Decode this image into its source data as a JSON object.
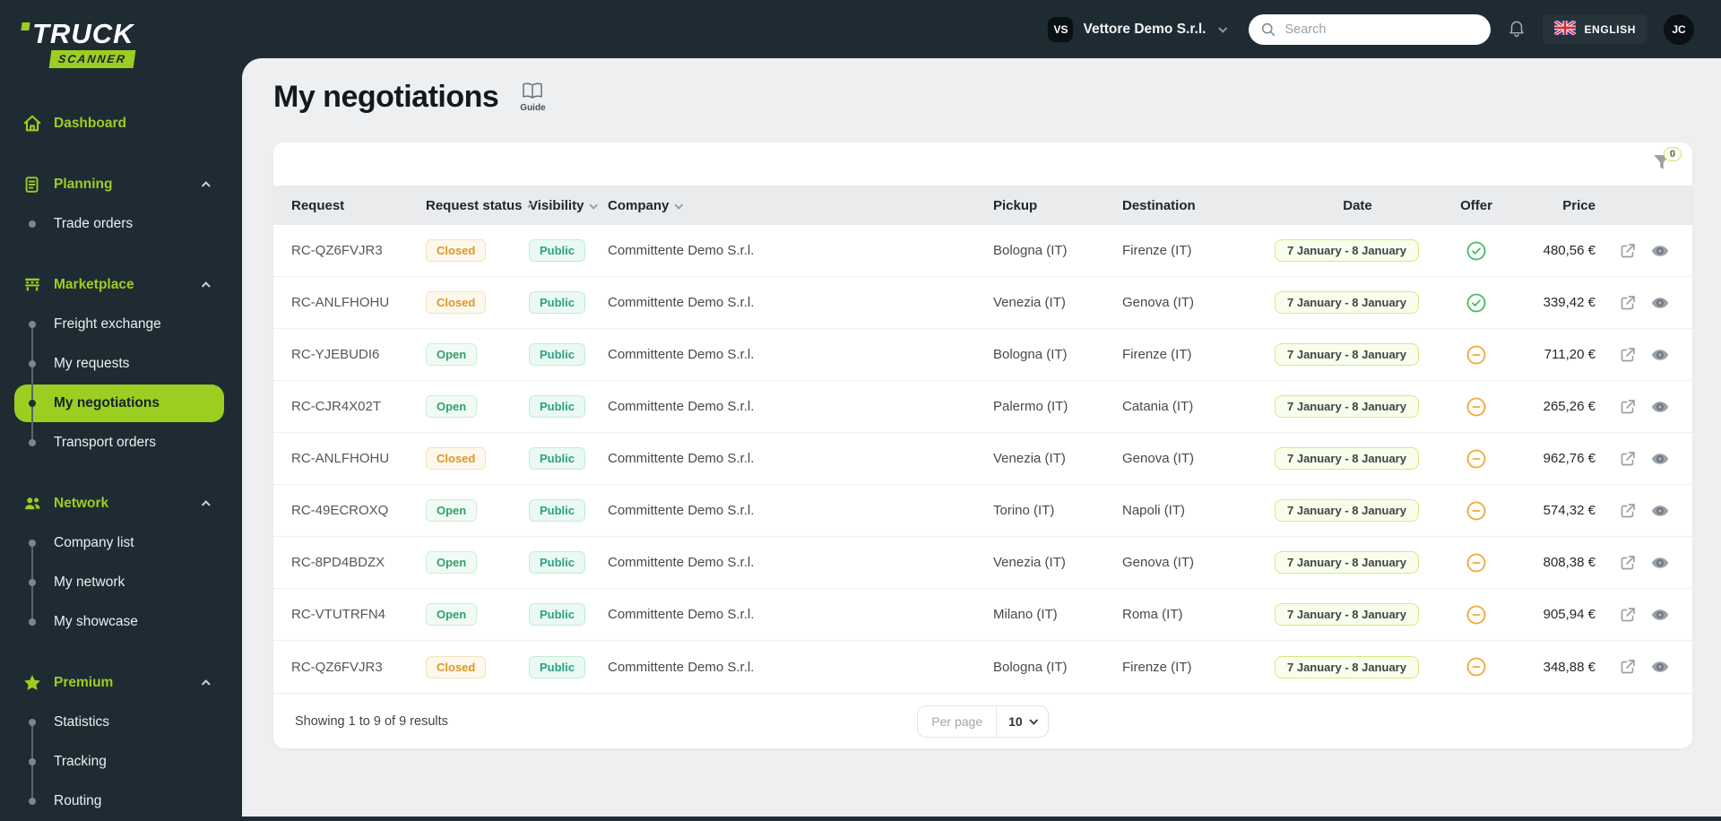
{
  "brand": {
    "name_line1": "TRUCK",
    "name_line2": "SCANNER"
  },
  "topbar": {
    "org_initials": "VS",
    "org_name": "Vettore Demo S.r.l.",
    "search_placeholder": "Search",
    "language_label": "ENGLISH",
    "user_initials": "JC"
  },
  "sidebar": {
    "sections": [
      {
        "label": "Dashboard",
        "items": []
      },
      {
        "label": "Planning",
        "items": [
          {
            "label": "Trade orders"
          }
        ]
      },
      {
        "label": "Marketplace",
        "items": [
          {
            "label": "Freight exchange"
          },
          {
            "label": "My requests"
          },
          {
            "label": "My negotiations",
            "active": true
          },
          {
            "label": "Transport orders"
          }
        ]
      },
      {
        "label": "Network",
        "items": [
          {
            "label": "Company list"
          },
          {
            "label": "My network"
          },
          {
            "label": "My showcase"
          }
        ]
      },
      {
        "label": "Premium",
        "items": [
          {
            "label": "Statistics"
          },
          {
            "label": "Tracking"
          },
          {
            "label": "Routing"
          }
        ]
      }
    ]
  },
  "page": {
    "title": "My negotiations",
    "guide_label": "Guide"
  },
  "filters": {
    "active_count": "0"
  },
  "table": {
    "columns": [
      "Request",
      "Request status",
      "Visibility",
      "Company",
      "Pickup",
      "Destination",
      "Date",
      "Offer",
      "Price"
    ],
    "rows": [
      {
        "request": "RC-QZ6FVJR3",
        "status_label": "Closed",
        "status_state": "closed",
        "visibility_label": "Public",
        "visibility_state": "public",
        "company": "Committente Demo S.r.l.",
        "pickup": "Bologna (IT)",
        "destination": "Firenze (IT)",
        "date_range": "7 January - 8 January",
        "offer_state": "accepted",
        "price": "480,56 €"
      },
      {
        "request": "RC-ANLFHOHU",
        "status_label": "Closed",
        "status_state": "closed",
        "visibility_label": "Public",
        "visibility_state": "public",
        "company": "Committente Demo S.r.l.",
        "pickup": "Venezia (IT)",
        "destination": "Genova (IT)",
        "date_range": "7 January - 8 January",
        "offer_state": "accepted",
        "price": "339,42 €"
      },
      {
        "request": "RC-YJEBUDI6",
        "status_label": "Open",
        "status_state": "open",
        "visibility_label": "Public",
        "visibility_state": "public",
        "company": "Committente Demo S.r.l.",
        "pickup": "Bologna (IT)",
        "destination": "Firenze (IT)",
        "date_range": "7 January - 8 January",
        "offer_state": "pending",
        "price": "711,20 €"
      },
      {
        "request": "RC-CJR4X02T",
        "status_label": "Open",
        "status_state": "open",
        "visibility_label": "Public",
        "visibility_state": "public",
        "company": "Committente Demo S.r.l.",
        "pickup": "Palermo (IT)",
        "destination": "Catania (IT)",
        "date_range": "7 January - 8 January",
        "offer_state": "pending",
        "price": "265,26 €"
      },
      {
        "request": "RC-ANLFHOHU",
        "status_label": "Closed",
        "status_state": "closed",
        "visibility_label": "Public",
        "visibility_state": "public",
        "company": "Committente Demo S.r.l.",
        "pickup": "Venezia (IT)",
        "destination": "Genova (IT)",
        "date_range": "7 January - 8 January",
        "offer_state": "pending",
        "price": "962,76 €"
      },
      {
        "request": "RC-49ECROXQ",
        "status_label": "Open",
        "status_state": "open",
        "visibility_label": "Public",
        "visibility_state": "public",
        "company": "Committente Demo S.r.l.",
        "pickup": "Torino (IT)",
        "destination": "Napoli (IT)",
        "date_range": "7 January - 8 January",
        "offer_state": "pending",
        "price": "574,32 €"
      },
      {
        "request": "RC-8PD4BDZX",
        "status_label": "Open",
        "status_state": "open",
        "visibility_label": "Public",
        "visibility_state": "public",
        "company": "Committente Demo S.r.l.",
        "pickup": "Venezia (IT)",
        "destination": "Genova (IT)",
        "date_range": "7 January - 8 January",
        "offer_state": "pending",
        "price": "808,38 €"
      },
      {
        "request": "RC-VTUTRFN4",
        "status_label": "Open",
        "status_state": "open",
        "visibility_label": "Public",
        "visibility_state": "public",
        "company": "Committente Demo S.r.l.",
        "pickup": "Milano (IT)",
        "destination": "Roma (IT)",
        "date_range": "7 January - 8 January",
        "offer_state": "pending",
        "price": "905,94 €"
      },
      {
        "request": "RC-QZ6FVJR3",
        "status_label": "Closed",
        "status_state": "closed",
        "visibility_label": "Public",
        "visibility_state": "public",
        "company": "Committente Demo S.r.l.",
        "pickup": "Bologna (IT)",
        "destination": "Firenze (IT)",
        "date_range": "7 January - 8 January",
        "offer_state": "pending",
        "price": "348,88 €"
      }
    ]
  },
  "pagination": {
    "summary": "Showing 1 to 9 of 9 results",
    "per_page_label": "Per page",
    "per_page_value": "10"
  },
  "colors": {
    "accent": "#9cce21",
    "sidebar_bg": "#1e2b33",
    "status_closed": "#dd9726",
    "status_open": "#31a06d",
    "visibility_public": "#2ba184",
    "offer_accepted": "#41bd63",
    "offer_pending": "#f0a83a"
  }
}
